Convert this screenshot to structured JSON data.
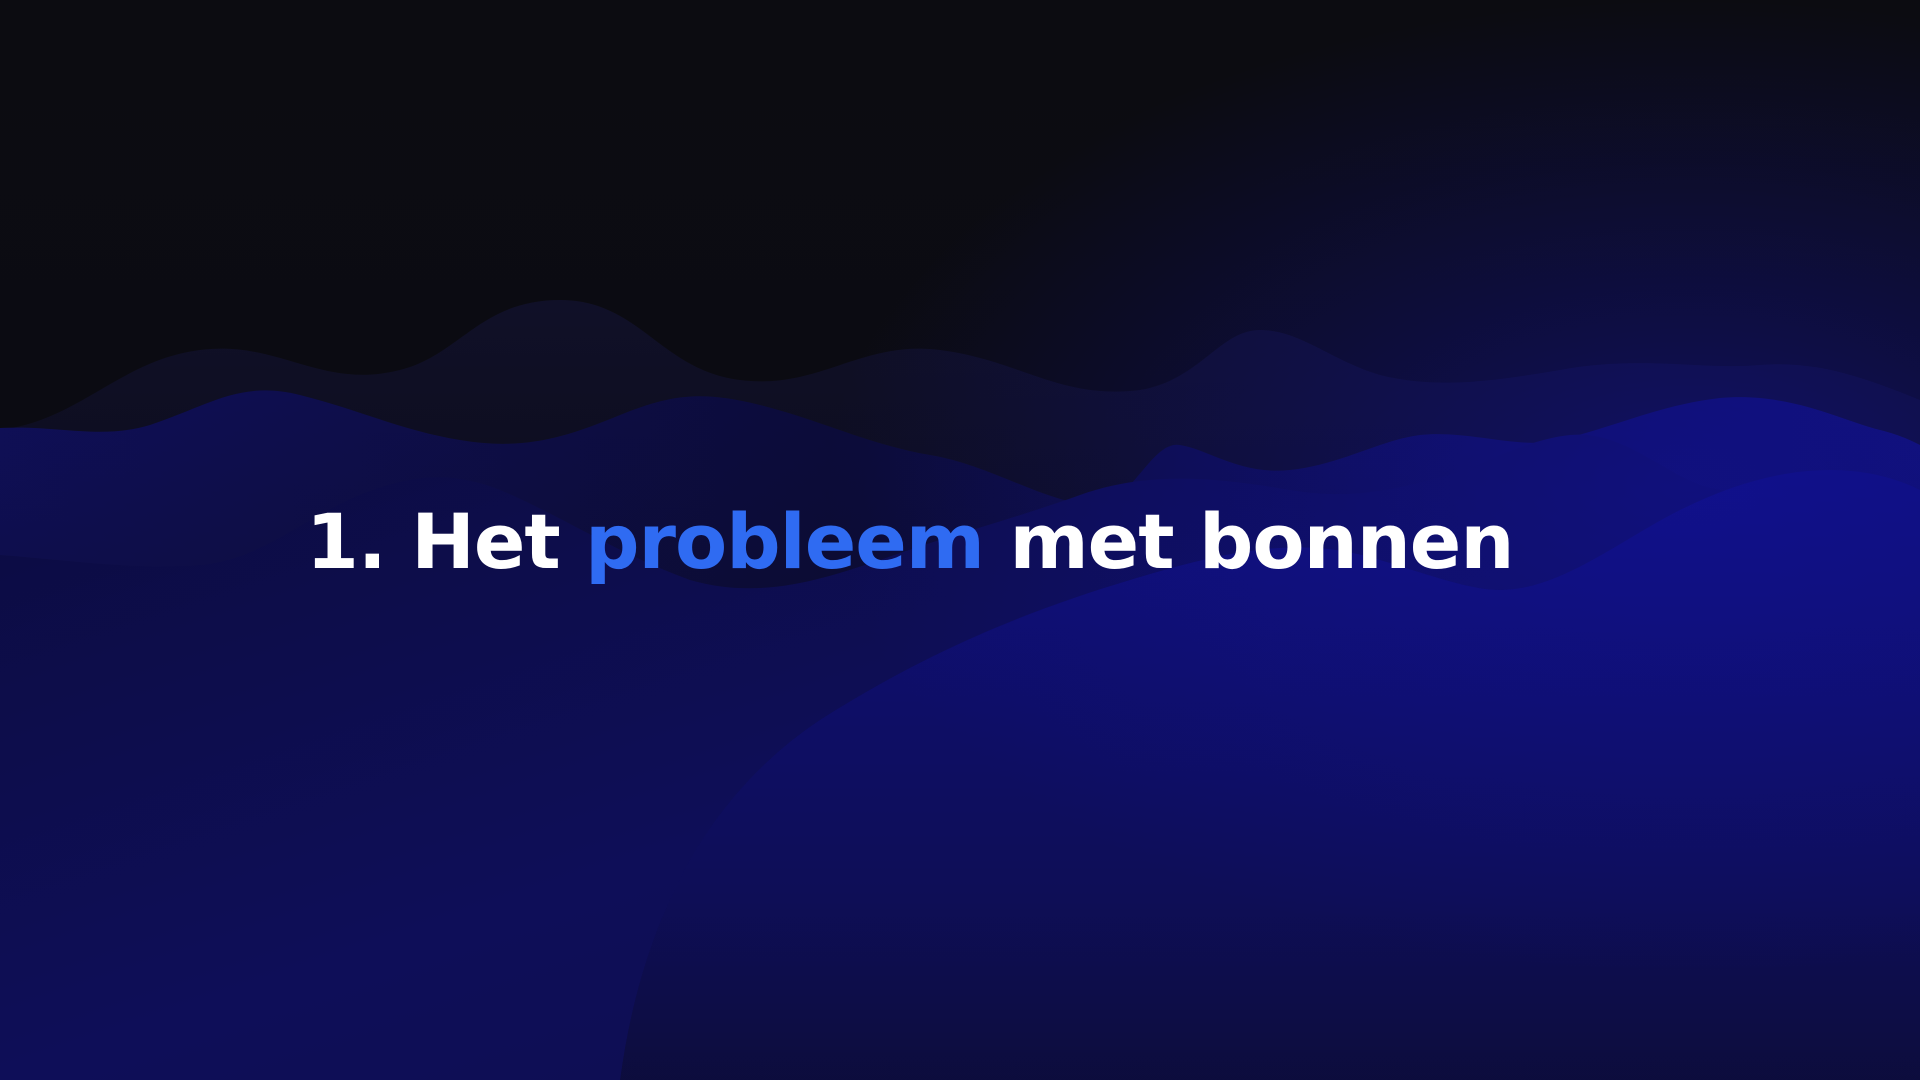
{
  "slide": {
    "title_prefix": "1. Het ",
    "title_highlight": "probleem",
    "title_suffix": " met bonnen"
  },
  "colors": {
    "background": "#0b0b10",
    "wave_deep": "#0d0d5e",
    "wave_bright": "#10108a",
    "text": "#ffffff",
    "accent": "#2f6bf2"
  }
}
